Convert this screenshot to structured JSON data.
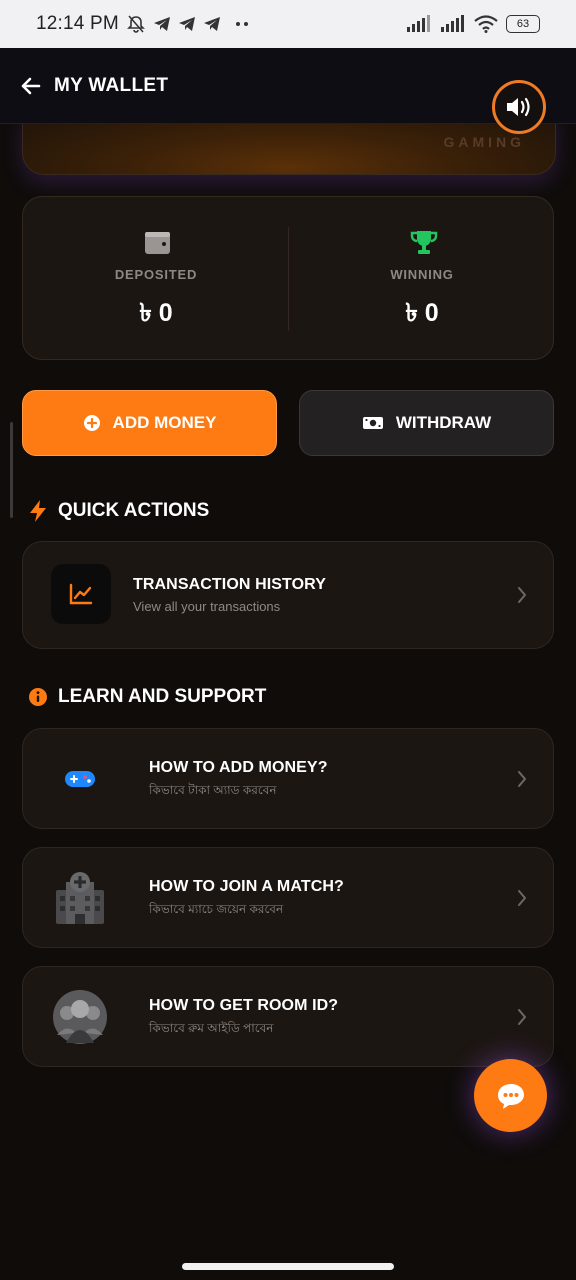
{
  "status_bar": {
    "time": "12:14 PM",
    "notification_icons": [
      "mute-bell-icon",
      "telegram-icon",
      "telegram-icon",
      "telegram-icon",
      "more-dots-icon"
    ],
    "signal_icons": [
      "signal-icon",
      "signal-icon",
      "wifi-icon"
    ],
    "battery": "63"
  },
  "header": {
    "title": "MY WALLET",
    "back_icon": "back-arrow-icon",
    "sound_icon": "speaker-icon"
  },
  "banner": {
    "brand_text": "GAMING"
  },
  "balance": {
    "deposited": {
      "label": "DEPOSITED",
      "value": "৳ 0",
      "icon": "wallet-icon"
    },
    "winning": {
      "label": "WINNING",
      "value": "৳ 0",
      "icon": "trophy-icon"
    }
  },
  "actions": {
    "add_money": {
      "label": "ADD MONEY",
      "icon": "plus-circle-icon"
    },
    "withdraw": {
      "label": "WITHDRAW",
      "icon": "cash-icon"
    }
  },
  "quick_actions": {
    "title": "QUICK ACTIONS",
    "icon": "lightning-icon",
    "items": [
      {
        "title": "TRANSACTION HISTORY",
        "subtitle": "View all your transactions",
        "icon": "chart-line-icon"
      }
    ]
  },
  "learn_support": {
    "title": "LEARN AND SUPPORT",
    "icon": "info-icon",
    "items": [
      {
        "title": "HOW TO ADD MONEY?",
        "subtitle": "কিভাবে টাকা অ্যাড করবেন",
        "icon": "gamepad-icon"
      },
      {
        "title": "HOW TO JOIN A MATCH?",
        "subtitle": "কিভাবে ম্যাচে জয়েন করবেন",
        "icon": "hospital-icon"
      },
      {
        "title": "HOW TO GET ROOM ID?",
        "subtitle": "কিভাবে রুম আইডি পাবেন",
        "icon": "group-avatar-icon"
      }
    ]
  },
  "chat_fab": {
    "icon": "chat-bubble-icon"
  },
  "colors": {
    "accent": "#fd7b12",
    "background": "#0f0c0a",
    "card": "#1c1612",
    "trophy": "#22c55e",
    "gamepad": "#1e88ff"
  }
}
